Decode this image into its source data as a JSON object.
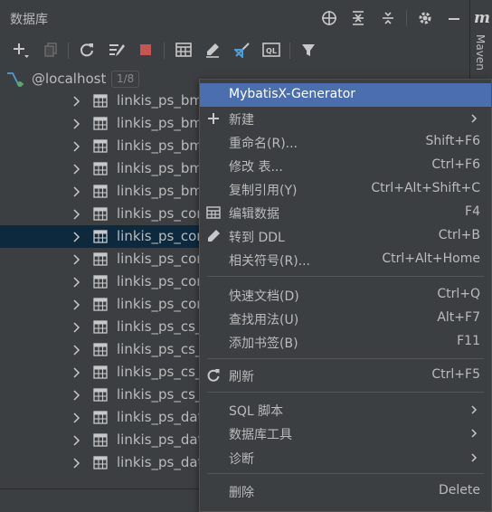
{
  "header": {
    "title": "数据库"
  },
  "side_panel": {
    "icon": "m",
    "label": "Maven"
  },
  "tree": {
    "root": {
      "label": "@localhost",
      "count": "1/8"
    },
    "rows": [
      {
        "label": "linkis_ps_bml_project"
      },
      {
        "label": "linkis_ps_bml_project_resource"
      },
      {
        "label": "linkis_ps_bml_project_user"
      },
      {
        "label": "linkis_ps_bml_resources"
      },
      {
        "label": "linkis_ps_bml_resources_task"
      },
      {
        "label": "linkis_ps_common_lock"
      },
      {
        "label": "linkis_ps_configuration_category"
      },
      {
        "label": "linkis_ps_configuration_config_key"
      },
      {
        "label": "linkis_ps_configuration_config_value"
      },
      {
        "label": "linkis_ps_configuration_key_engine_relation"
      },
      {
        "label": "linkis_ps_cs_context_history"
      },
      {
        "label": "linkis_ps_cs_context_id"
      },
      {
        "label": "linkis_ps_cs_context_listener"
      },
      {
        "label": "linkis_ps_cs_context_map"
      },
      {
        "label": "linkis_ps_datasource_access"
      },
      {
        "label": "linkis_ps_datasource_field"
      },
      {
        "label": "linkis_ps_datasource_import"
      }
    ]
  },
  "menu": {
    "items": [
      {
        "label": "MybatisX-Generator",
        "shortcut": ""
      },
      {
        "label": "新建",
        "shortcut": ""
      },
      {
        "label": "重命名(R)...",
        "shortcut": "Shift+F6"
      },
      {
        "label": "修改 表...",
        "shortcut": "Ctrl+F6"
      },
      {
        "label": "复制引用(Y)",
        "shortcut": "Ctrl+Alt+Shift+C"
      },
      {
        "label": "编辑数据",
        "shortcut": "F4"
      },
      {
        "label": "转到 DDL",
        "shortcut": "Ctrl+B"
      },
      {
        "label": "相关符号(R)...",
        "shortcut": "Ctrl+Alt+Home"
      },
      {
        "label": "快速文档(D)",
        "shortcut": "Ctrl+Q"
      },
      {
        "label": "查找用法(U)",
        "shortcut": "Alt+F7"
      },
      {
        "label": "添加书签(B)",
        "shortcut": "F11"
      },
      {
        "label": "刷新",
        "shortcut": "Ctrl+F5"
      },
      {
        "label": "SQL 脚本",
        "shortcut": ""
      },
      {
        "label": "数据库工具",
        "shortcut": ""
      },
      {
        "label": "诊断",
        "shortcut": ""
      },
      {
        "label": "删除",
        "shortcut": "Delete"
      }
    ]
  },
  "colors": {
    "selection": "#0d293e",
    "highlight": "#4b6eaf",
    "panel": "#3c3f41"
  }
}
